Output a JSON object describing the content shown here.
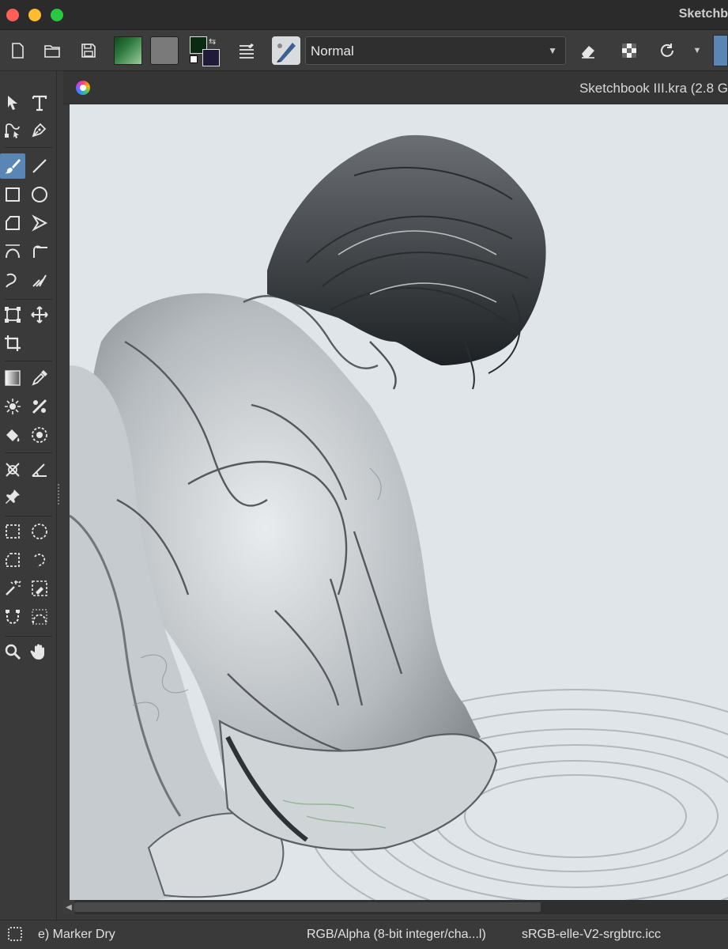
{
  "window": {
    "title": "Sketchb"
  },
  "toolbar": {
    "blend_mode": "Normal",
    "foreground_color": "#0a2a12",
    "background_color": "#1f1a38",
    "buttons": [
      {
        "name": "new-document",
        "icon": "new-document-icon"
      },
      {
        "name": "open-document",
        "icon": "folder-icon"
      },
      {
        "name": "save-document",
        "icon": "save-icon"
      },
      {
        "name": "edit-brush-settings",
        "icon": "brush-settings-icon"
      },
      {
        "name": "eraser-mode",
        "icon": "eraser-icon"
      },
      {
        "name": "preserve-alpha",
        "icon": "checkerboard-icon"
      },
      {
        "name": "reload-preset",
        "icon": "refresh-icon"
      }
    ]
  },
  "document": {
    "tab_title": "Sketchbook III.kra (2.8 G"
  },
  "statusbar": {
    "brush_name": "e) Marker Dry",
    "color_model": "RGB/Alpha (8-bit integer/cha...l)",
    "color_profile": "sRGB-elle-V2-srgbtrc.icc"
  },
  "colors": {
    "accent": "#5a86b6",
    "canvas_paper": "#dfe5e8",
    "panel": "#3a3a3a"
  }
}
